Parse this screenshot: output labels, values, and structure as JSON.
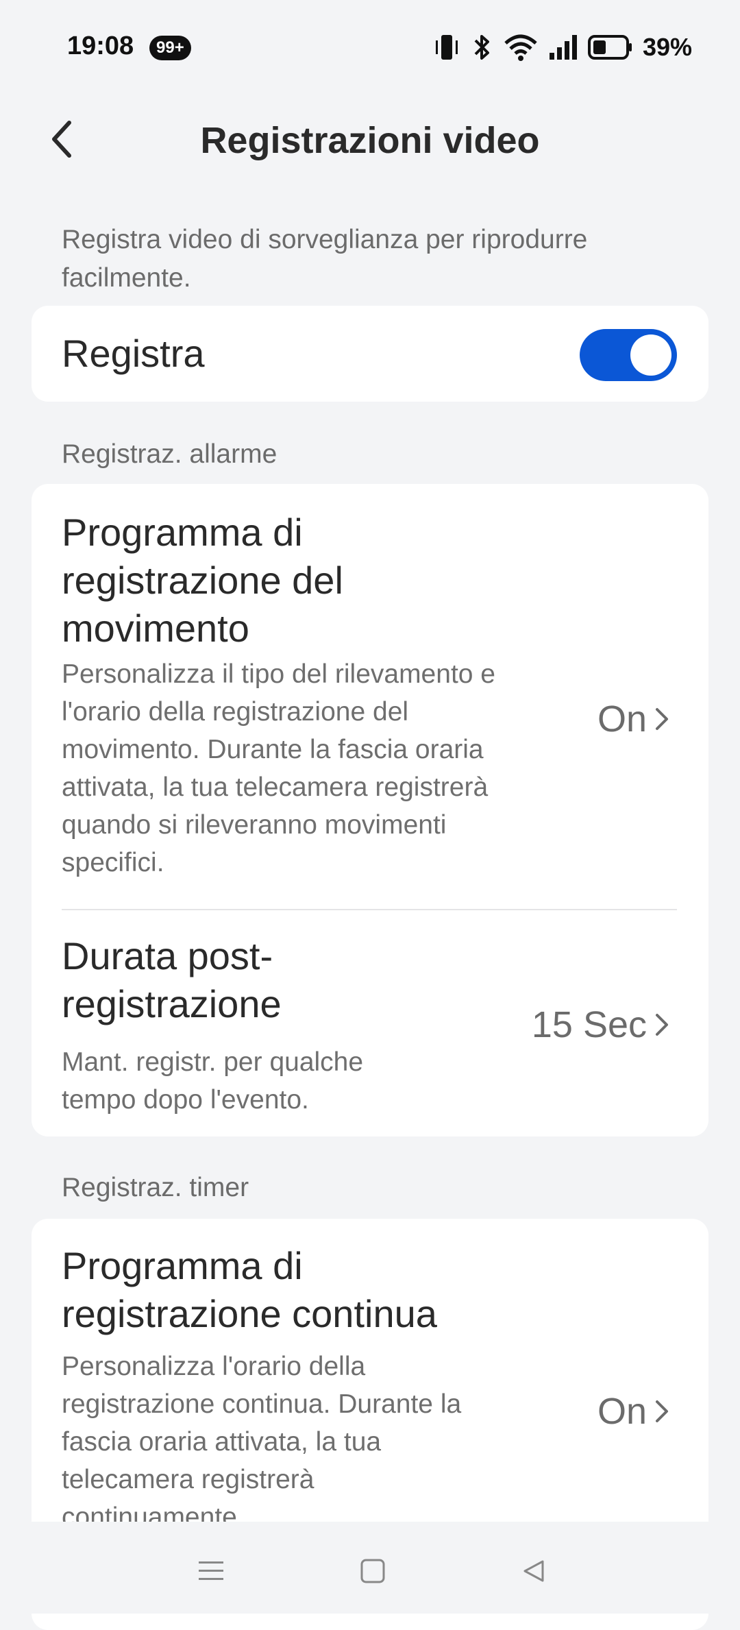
{
  "status_bar": {
    "time": "19:08",
    "notification_badge": "99+",
    "battery_percent": "39%",
    "icons": [
      "vibrate-icon",
      "bluetooth-icon",
      "wifi-icon",
      "signal-icon",
      "battery-icon"
    ]
  },
  "header": {
    "title": "Registrazioni video",
    "back_icon": "chevron-left-icon"
  },
  "intro_text": "Registra video di sorveglianza per riprodurre facilmente.",
  "record_toggle": {
    "label": "Registra",
    "enabled": true,
    "accent_color": "#0b57d6"
  },
  "alarm_section": {
    "label": "Registraz. allarme",
    "items": [
      {
        "title": "Programma di registrazione del movimento",
        "description": "Personalizza il tipo del rilevamento e l'orario della registrazione del movimento. Durante la fascia oraria attivata, la tua telecamera registrerà quando si rileveranno movimenti specifici.",
        "value": "On"
      },
      {
        "title": "Durata post-registrazione",
        "description": "Mant. registr. per qualche tempo dopo l'evento.",
        "value": "15 Sec"
      }
    ]
  },
  "timer_section": {
    "label": "Registraz. timer",
    "items": [
      {
        "title": "Programma di registrazione continua",
        "description": "Personalizza l'orario della registrazione continua. Durante la fascia oraria attivata, la tua telecamera registrerà continuamente.",
        "value": "On"
      }
    ]
  },
  "nav_bar": {
    "icons": [
      "menu-icon",
      "home-square-icon",
      "back-triangle-icon"
    ]
  }
}
